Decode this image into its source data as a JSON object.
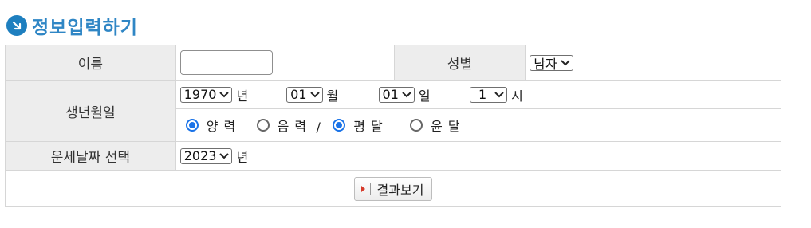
{
  "header": {
    "title": "정보입력하기",
    "icon": "arrow-down-right-circle-icon",
    "accent": "#2f86c5"
  },
  "form": {
    "name_label": "이름",
    "name_value": "",
    "gender_label": "성별",
    "gender_value": "남자",
    "birth_label": "생년월일",
    "year_value": "1970",
    "year_unit": "년",
    "month_value": "01",
    "month_unit": "월",
    "day_value": "01",
    "day_unit": "일",
    "hour_value": "1",
    "hour_unit": "시",
    "calendar": [
      {
        "label": "양력",
        "checked": true
      },
      {
        "label": "음력",
        "checked": false
      }
    ],
    "calendar_sep": "/",
    "month_type": [
      {
        "label": "평달",
        "checked": true
      },
      {
        "label": "윤달",
        "checked": false
      }
    ],
    "fortune_label": "운세날짜 선택",
    "fortune_year_value": "2023",
    "fortune_year_unit": "년",
    "submit_label": "결과보기"
  }
}
